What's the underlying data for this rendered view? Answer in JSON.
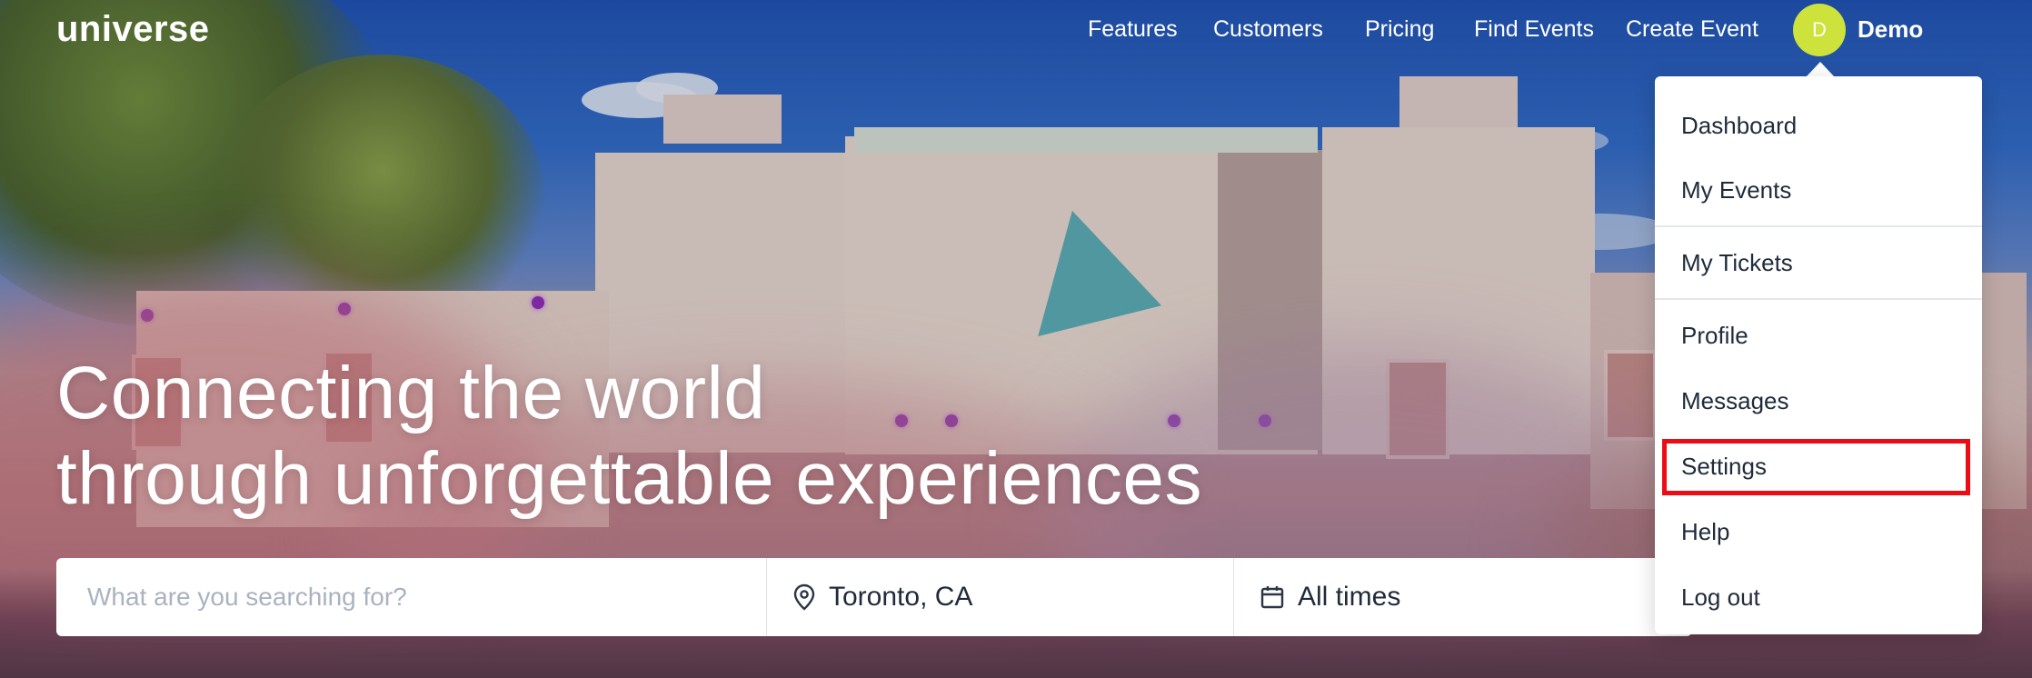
{
  "brand": {
    "logo_text": "universe"
  },
  "nav": {
    "links": [
      "Features",
      "Customers",
      "Pricing",
      "Find Events",
      "Create Event"
    ],
    "avatar_initial": "D",
    "user_name": "Demo"
  },
  "hero": {
    "headline_line1": "Connecting the world",
    "headline_line2": "through unforgettable experiences"
  },
  "search": {
    "what_placeholder": "What are you searching for?",
    "where_value": "Toronto, CA",
    "when_value": "All times",
    "where_icon": "map-pin-icon",
    "when_icon": "calendar-icon"
  },
  "user_menu": {
    "items": [
      "Dashboard",
      "My Events",
      "My Tickets",
      "Profile",
      "Messages",
      "Settings",
      "Help",
      "Log out"
    ],
    "highlighted_item": "Settings",
    "highlight_color": "#ee0c14"
  },
  "colors": {
    "avatar": "#cde23a",
    "text_dark": "#1f2b3a"
  }
}
